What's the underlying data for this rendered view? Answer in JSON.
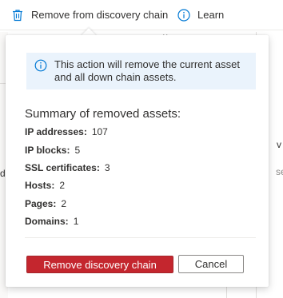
{
  "toolbar": {
    "remove_label": "Remove from discovery chain",
    "remove_icon": "trash-icon",
    "learn_label": "Learn",
    "learn_icon": "info-icon"
  },
  "background": {
    "peek_left": "d",
    "peek_right_1": "v",
    "peek_right_2": "se"
  },
  "callout": {
    "info_message": "This action will remove the current asset and all down chain assets.",
    "summary_title": "Summary of removed assets:",
    "summary_items": [
      {
        "label": "IP addresses:",
        "value": "107"
      },
      {
        "label": "IP blocks:",
        "value": "5"
      },
      {
        "label": "SSL certificates:",
        "value": "3"
      },
      {
        "label": "Hosts:",
        "value": "2"
      },
      {
        "label": "Pages:",
        "value": "2"
      },
      {
        "label": "Domains:",
        "value": "1"
      }
    ],
    "primary_button": "Remove discovery chain",
    "secondary_button": "Cancel"
  },
  "colors": {
    "accent_blue": "#0078d4",
    "danger_red": "#c4262e",
    "info_background": "#eaf3fc"
  }
}
